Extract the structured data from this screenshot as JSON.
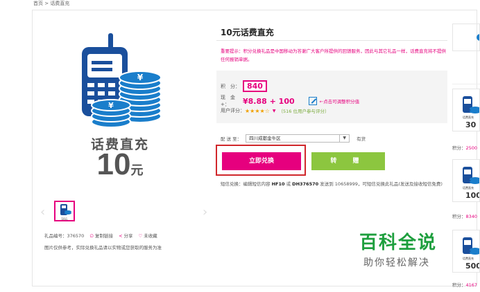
{
  "breadcrumb": "首页 > 话费直充",
  "product": {
    "hero_title": "话费直充",
    "hero_amount": "10",
    "hero_unit": "元",
    "thumb_caption": "10元",
    "title": "10元话费直充",
    "tip": "重要提示：积分兑换礼品是中国移动为答谢广大客户所提供的回馈服务，因此与其它礼品一样，话费直充将不提供任何报销单据。",
    "points_label": "积　分：",
    "points_value": "840",
    "cash_label": "现　金+：",
    "cash_value": "¥8.88 + 100",
    "adjust_link": "←点击可调整积分值",
    "rating_label": "用户评分：",
    "rating_stars": "★★★★☆",
    "rating_count": "（516 位用户参与评分）",
    "ship_label": "配 送 至：",
    "region": "四川成都金牛区",
    "stock": "有货",
    "redeem_button": "立即兑换",
    "gift_button": "转 赠",
    "sms_text_1": "短信兑换：编辑短信内容",
    "sms_code_1": "HF10",
    "sms_or": "或",
    "sms_code_2": "DH376570",
    "sms_text_2": "发送到 10658999，可短信兑换此礼品(发送及接收短信免费)",
    "gift_id_label": "礼品编号：376570",
    "copy_link": "复制链接",
    "share": "分享",
    "favorite": "未收藏",
    "image_note": "图片仅供参考，实际兑换礼品请以实物或您获取的服务为准"
  },
  "watermark": {
    "big": "百科全说",
    "small": "助你轻松解决"
  },
  "sidebar": {
    "items": [
      {
        "amount": "30",
        "caption": "话费直充",
        "points_label": "积分：",
        "points": "2500"
      },
      {
        "amount": "100",
        "caption": "话费直充",
        "points_label": "积分：",
        "points": "8340"
      },
      {
        "amount": "500",
        "caption": "话费直充",
        "points_label": "积分：",
        "points": "4167"
      }
    ]
  },
  "colors": {
    "brand": "#e6007e",
    "phone_blue": "#1a4f9c",
    "gift_green": "#8cc63f",
    "highlight_red": "#d0272b",
    "watermark_green": "#1e9f3e"
  }
}
